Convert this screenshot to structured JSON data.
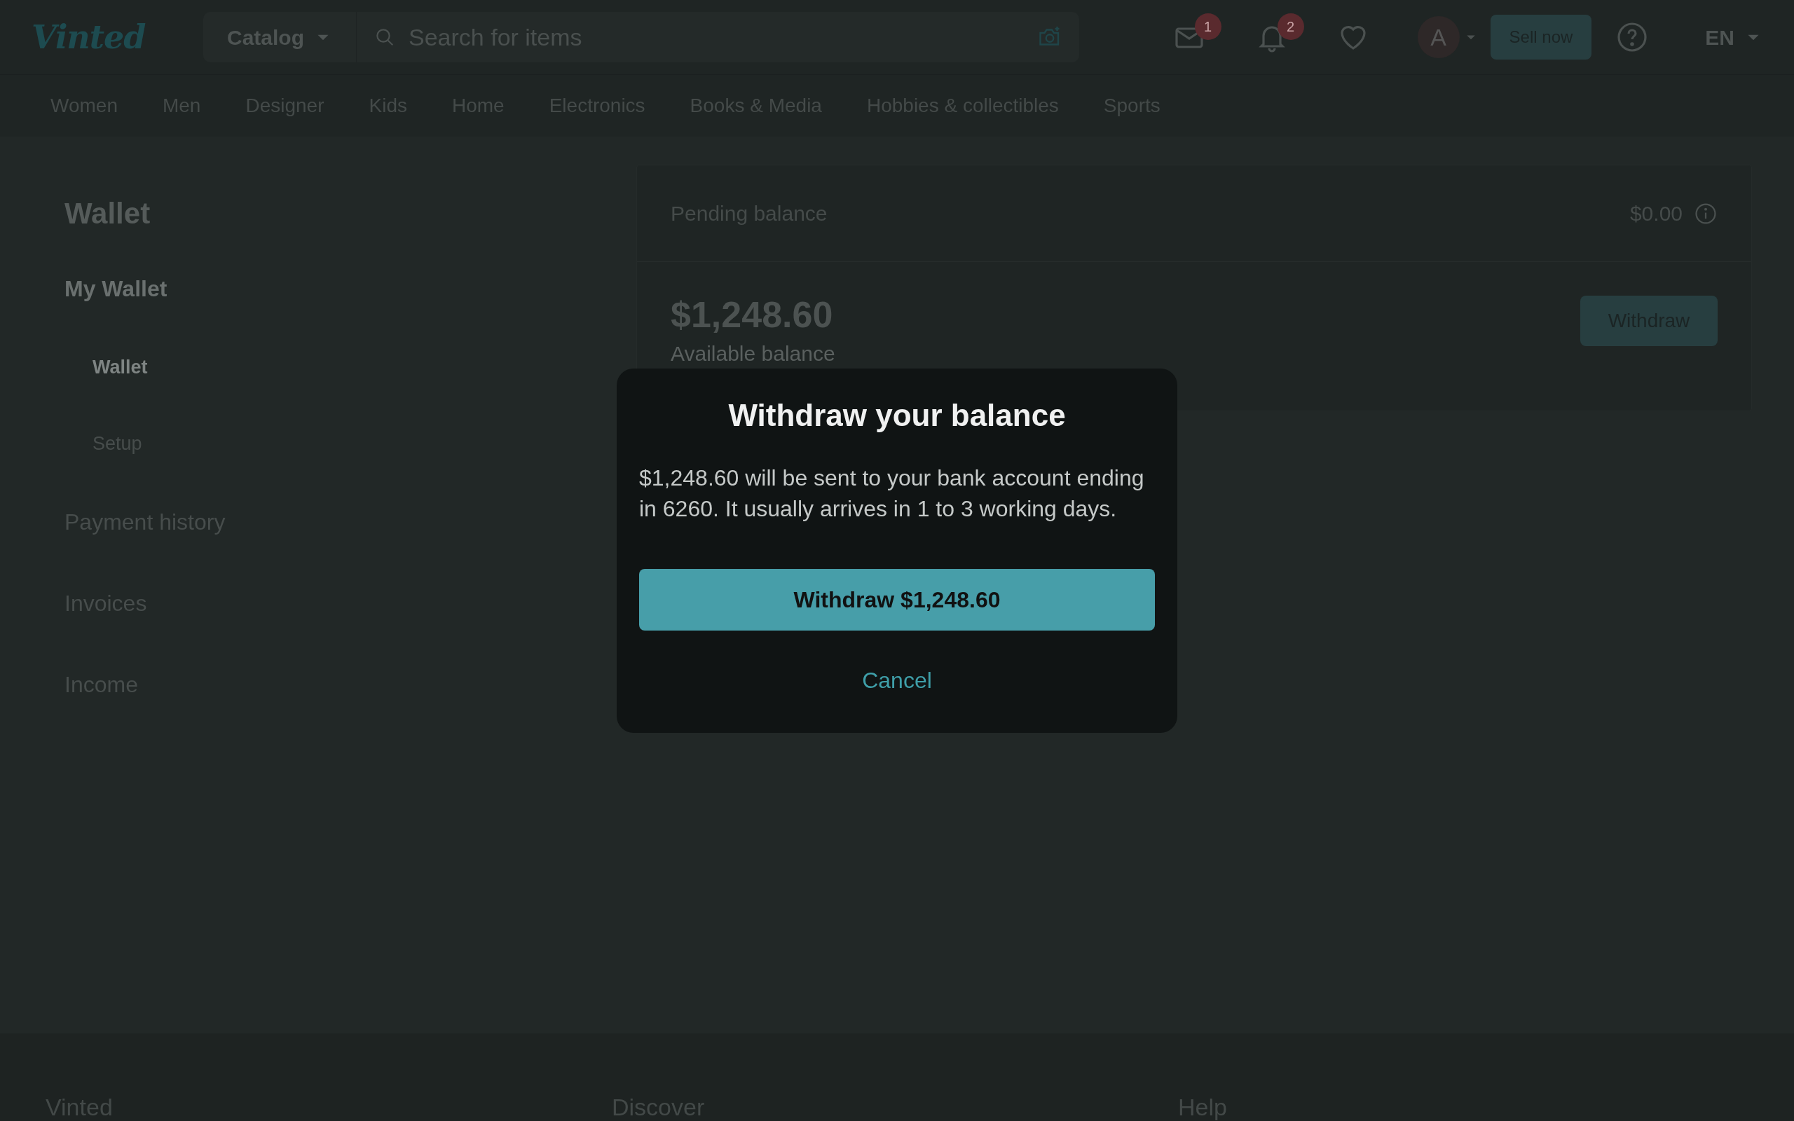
{
  "header": {
    "logo": "Vinted",
    "catalog_button": "Catalog",
    "search": {
      "placeholder": "Search for items"
    },
    "inbox_badge": "1",
    "notifications_badge": "2",
    "avatar": "A",
    "sell_button": "Sell now",
    "language": "EN"
  },
  "categories": [
    "Women",
    "Men",
    "Designer",
    "Kids",
    "Home",
    "Electronics",
    "Books & Media",
    "Hobbies & collectibles",
    "Sports"
  ],
  "sidebar": {
    "title": "Wallet",
    "items": [
      {
        "label": "My Wallet",
        "selected": true,
        "children": [
          {
            "label": "Wallet",
            "selected": true
          },
          {
            "label": "Setup",
            "selected": false
          }
        ]
      },
      {
        "label": "Payment history",
        "selected": false
      },
      {
        "label": "Invoices",
        "selected": false
      },
      {
        "label": "Income",
        "selected": false
      }
    ]
  },
  "wallet_card": {
    "pending_label": "Pending balance",
    "pending_amount": "$0.00",
    "available_amount": "$1,248.60",
    "available_label": "Available balance",
    "withdraw_button": "Withdraw"
  },
  "modal": {
    "title": "Withdraw your balance",
    "body": "$1,248.60 will be sent to your bank account ending in 6260. It usually arrives in 1 to 3 working days.",
    "confirm_button": "Withdraw $1,248.60",
    "cancel_button": "Cancel"
  },
  "footer": {
    "columns": [
      "Vinted",
      "Discover",
      "Help"
    ]
  }
}
